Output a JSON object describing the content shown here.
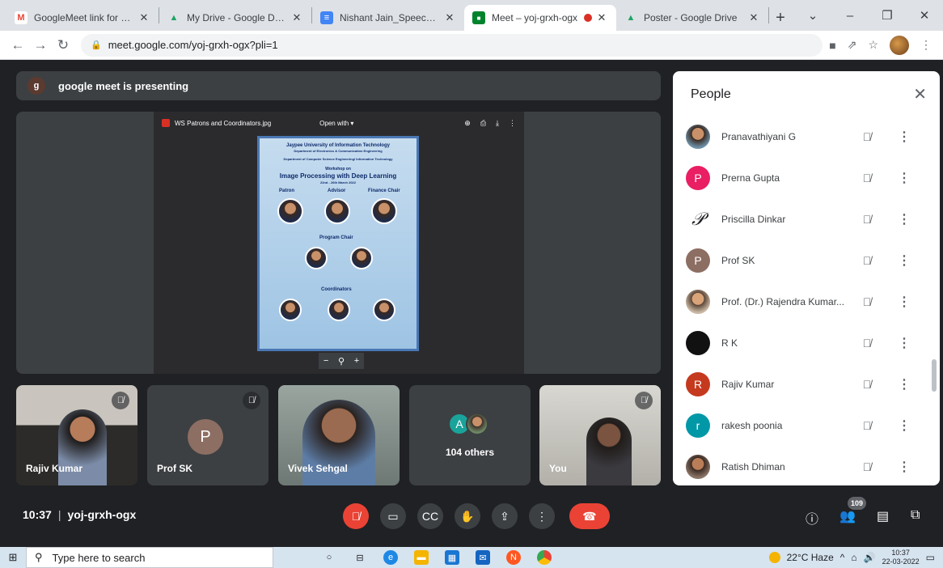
{
  "browser": {
    "tabs": [
      {
        "title": "GoogleMeet link for WS on",
        "favicon": "M",
        "favicon_color": "#ea4335"
      },
      {
        "title": "My Drive - Google Drive",
        "favicon": "▲",
        "favicon_color": "#1fa463"
      },
      {
        "title": "Nishant Jain_Speech - Goo",
        "favicon": "≡",
        "favicon_color": "#4285f4"
      },
      {
        "title": "Meet – yoj-grxh-ogx",
        "favicon": "■",
        "favicon_color": "#00832d",
        "active": true,
        "recording": true
      },
      {
        "title": "Poster - Google Drive",
        "favicon": "▲",
        "favicon_color": "#1fa463"
      }
    ],
    "url": "meet.google.com/yoj-grxh-ogx?pli=1"
  },
  "meet": {
    "presenting_avatar": "g",
    "presenting_text": "google meet is presenting",
    "viewer": {
      "file_name": "WS Patrons and Coordinators.jpg",
      "open_with": "Open with ▾"
    },
    "poster": {
      "university": "Jaypee University of Information Technology",
      "dept1": "Department of Electronics & Communication Engineering",
      "dept2": "Department of Computer Science Engineering/ Information Technology",
      "workshop_on": "Workshop on",
      "workshop_title": "Image Processing with Deep Learning",
      "dates": "22nd - 26th March 2022",
      "patron": "Patron",
      "advisor": "Advisor",
      "finance_chair": "Finance Chair",
      "program_chair": "Program Chair",
      "coordinators": "Coordinators"
    },
    "tiles": [
      {
        "name": "Rajiv Kumar",
        "muted": true
      },
      {
        "name": "Prof SK",
        "initial": "P",
        "muted": true
      },
      {
        "name": "Vivek Sehgal",
        "muted": false
      },
      {
        "avatar_initial": "A",
        "label": "104 others"
      },
      {
        "name": "You",
        "muted": true
      }
    ],
    "time": "10:37",
    "meeting_code": "yoj-grxh-ogx",
    "participant_count": "109"
  },
  "people_panel": {
    "title": "People",
    "participants": [
      {
        "name": "Pranavathiyani G",
        "avatar_type": "photo"
      },
      {
        "name": "Prerna Gupta",
        "initial": "P",
        "color": "#e91e63"
      },
      {
        "name": "Priscilla Dinkar",
        "initial": "𝒫",
        "color": "#ffffff"
      },
      {
        "name": "Prof SK",
        "initial": "P",
        "color": "#8d6e63"
      },
      {
        "name": "Prof. (Dr.) Rajendra Kumar...",
        "avatar_type": "photo"
      },
      {
        "name": "R K",
        "initial": "",
        "color": "#111111"
      },
      {
        "name": "Rajiv Kumar",
        "initial": "R",
        "color": "#c5391e"
      },
      {
        "name": "rakesh poonia",
        "initial": "r",
        "color": "#0097a7"
      },
      {
        "name": "Ratish Dhiman",
        "avatar_type": "photo"
      }
    ]
  },
  "taskbar": {
    "search_placeholder": "Type here to search",
    "weather": "22°C Haze",
    "time": "10:37",
    "date": "22-03-2022"
  }
}
